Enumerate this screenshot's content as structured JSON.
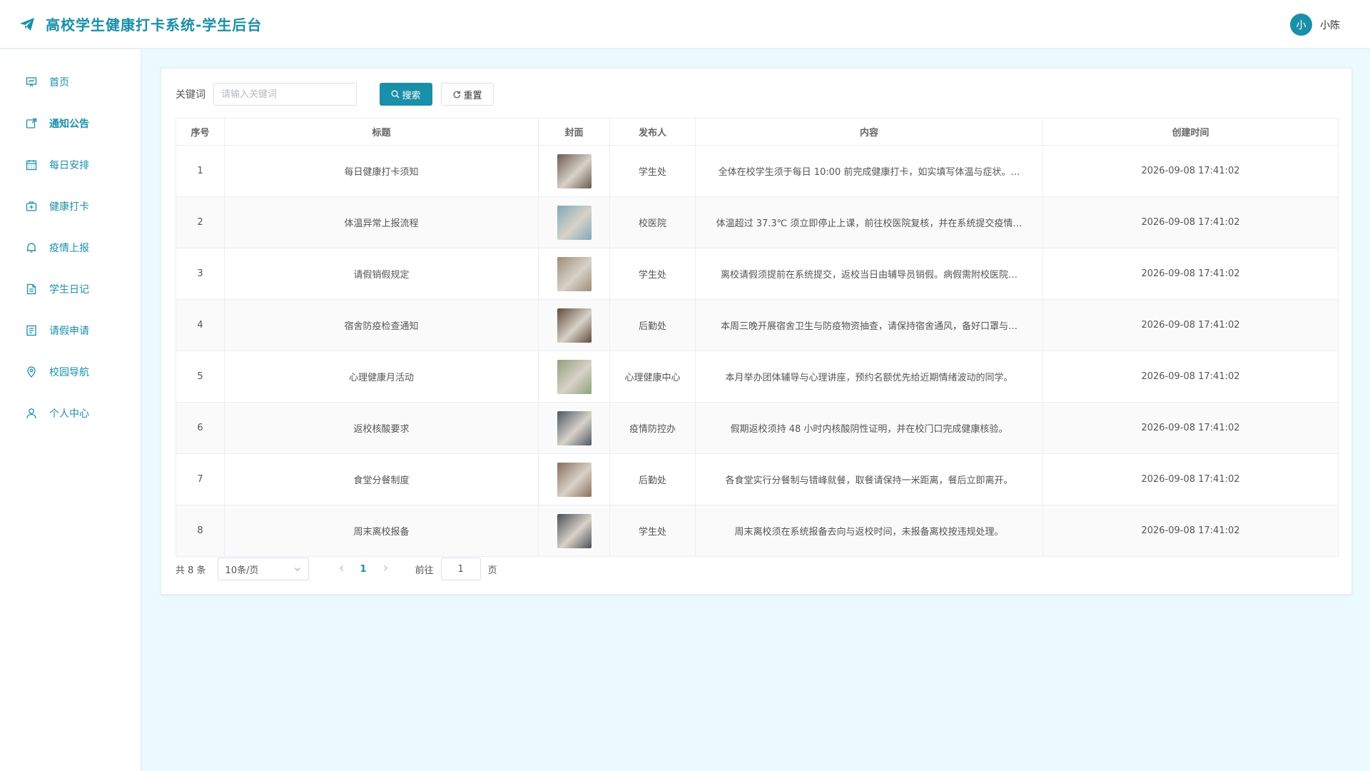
{
  "header": {
    "title": "高校学生健康打卡系统-学生后台",
    "avatar_text": "小",
    "user_name": "小陈"
  },
  "sidebar": {
    "items": [
      {
        "label": "首页",
        "icon": "monitor-icon"
      },
      {
        "label": "通知公告",
        "icon": "notice-icon"
      },
      {
        "label": "每日安排",
        "icon": "calendar-icon"
      },
      {
        "label": "健康打卡",
        "icon": "medical-kit-icon"
      },
      {
        "label": "疫情上报",
        "icon": "bell-icon"
      },
      {
        "label": "学生日记",
        "icon": "document-icon"
      },
      {
        "label": "请假申请",
        "icon": "form-icon"
      },
      {
        "label": "校园导航",
        "icon": "location-icon"
      },
      {
        "label": "个人中心",
        "icon": "user-icon"
      }
    ]
  },
  "search": {
    "label": "关键词",
    "placeholder": "请输入关键词",
    "value": "",
    "search_label": "搜索",
    "reset_label": "重置"
  },
  "table": {
    "headers": [
      "序号",
      "标题",
      "封面",
      "发布人",
      "内容",
      "创建时间"
    ],
    "rows": [
      {
        "no": "1",
        "title": "每日健康打卡须知",
        "publisher": "学生处",
        "content": "全体在校学生须于每日 10:00 前完成健康打卡，如实填写体温与症状。…",
        "time": "2026-09-08 17:41:02",
        "cover_color": "#6a5b4e"
      },
      {
        "no": "2",
        "title": "体温异常上报流程",
        "publisher": "校医院",
        "content": "体温超过 37.3℃ 须立即停止上课，前往校医院复核，并在系统提交疫情…",
        "time": "2026-09-08 17:41:02",
        "cover_color": "#7fa9b8"
      },
      {
        "no": "3",
        "title": "请假销假规定",
        "publisher": "学生处",
        "content": "离校请假须提前在系统提交，返校当日由辅导员销假。病假需附校医院…",
        "time": "2026-09-08 17:41:02",
        "cover_color": "#9e8d7a"
      },
      {
        "no": "4",
        "title": "宿舍防疫检查通知",
        "publisher": "后勤处",
        "content": "本周三晚开展宿舍卫生与防疫物资抽查，请保持宿舍通风，备好口罩与…",
        "time": "2026-09-08 17:41:02",
        "cover_color": "#5e4a3a"
      },
      {
        "no": "5",
        "title": "心理健康月活动",
        "publisher": "心理健康中心",
        "content": "本月举办团体辅导与心理讲座，预约名额优先给近期情绪波动的同学。",
        "time": "2026-09-08 17:41:02",
        "cover_color": "#8fa07c"
      },
      {
        "no": "6",
        "title": "返校核酸要求",
        "publisher": "疫情防控办",
        "content": "假期返校须持 48 小时内核酸阴性证明，并在校门口完成健康核验。",
        "time": "2026-09-08 17:41:02",
        "cover_color": "#4d5766"
      },
      {
        "no": "7",
        "title": "食堂分餐制度",
        "publisher": "后勤处",
        "content": "各食堂实行分餐制与错峰就餐，取餐请保持一米距离，餐后立即离开。",
        "time": "2026-09-08 17:41:02",
        "cover_color": "#8a6d5c"
      },
      {
        "no": "8",
        "title": "周末离校报备",
        "publisher": "学生处",
        "content": "周末离校须在系统报备去向与返校时间，未报备离校按违规处理。",
        "time": "2026-09-08 17:41:02",
        "cover_color": "#4a4f58"
      }
    ]
  },
  "pagination": {
    "total_text": "共 8 条",
    "page_size": "10条/页",
    "current_page": "1",
    "goto_label": "前往",
    "goto_value": "1",
    "page_unit": "页"
  },
  "colors": {
    "accent": "#1a8fa8",
    "background": "#eafaff"
  }
}
